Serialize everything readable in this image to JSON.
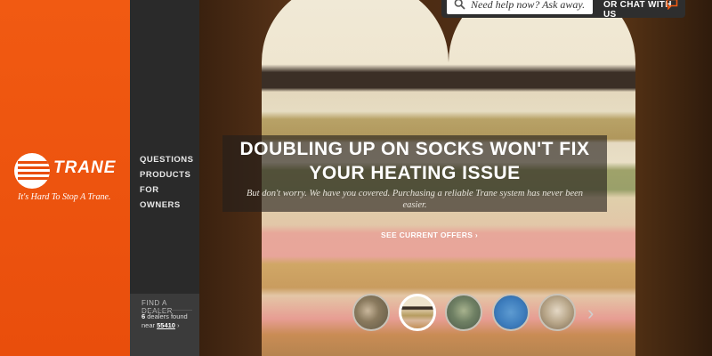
{
  "brand": {
    "logo_text": "TRANE",
    "tagline": "It's Hard To Stop A Trane.",
    "color": "#e94e0c"
  },
  "nav": {
    "items": [
      {
        "label": "QUESTIONS"
      },
      {
        "label": "PRODUCTS"
      },
      {
        "label": "FOR OWNERS"
      }
    ]
  },
  "dealer": {
    "title": "FIND A DEALER",
    "count": "6",
    "found_text": "dealers found",
    "near_text": "near",
    "zip": "55410",
    "arrow": "›"
  },
  "header": {
    "search_placeholder": "Need help now? Ask away.",
    "chat_label": "OR CHAT WITH US",
    "search_icon": "search-icon",
    "chat_icon": "chat-bubble-icon"
  },
  "hero": {
    "headline_line1": "DOUBLING UP ON SOCKS WON'T FIX",
    "headline_line2": "YOUR HEATING ISSUE",
    "subtext": "But don't worry. We have you covered. Purchasing a reliable Trane system has never been easier.",
    "cta": "SEE CURRENT OFFERS ›"
  },
  "carousel": {
    "next_icon": "›",
    "thumbnails": [
      {
        "name": "thumb-family",
        "active": false
      },
      {
        "name": "thumb-socks",
        "active": true
      },
      {
        "name": "thumb-outdoor",
        "active": false
      },
      {
        "name": "thumb-blue",
        "active": false
      },
      {
        "name": "thumb-person",
        "active": false
      }
    ]
  }
}
